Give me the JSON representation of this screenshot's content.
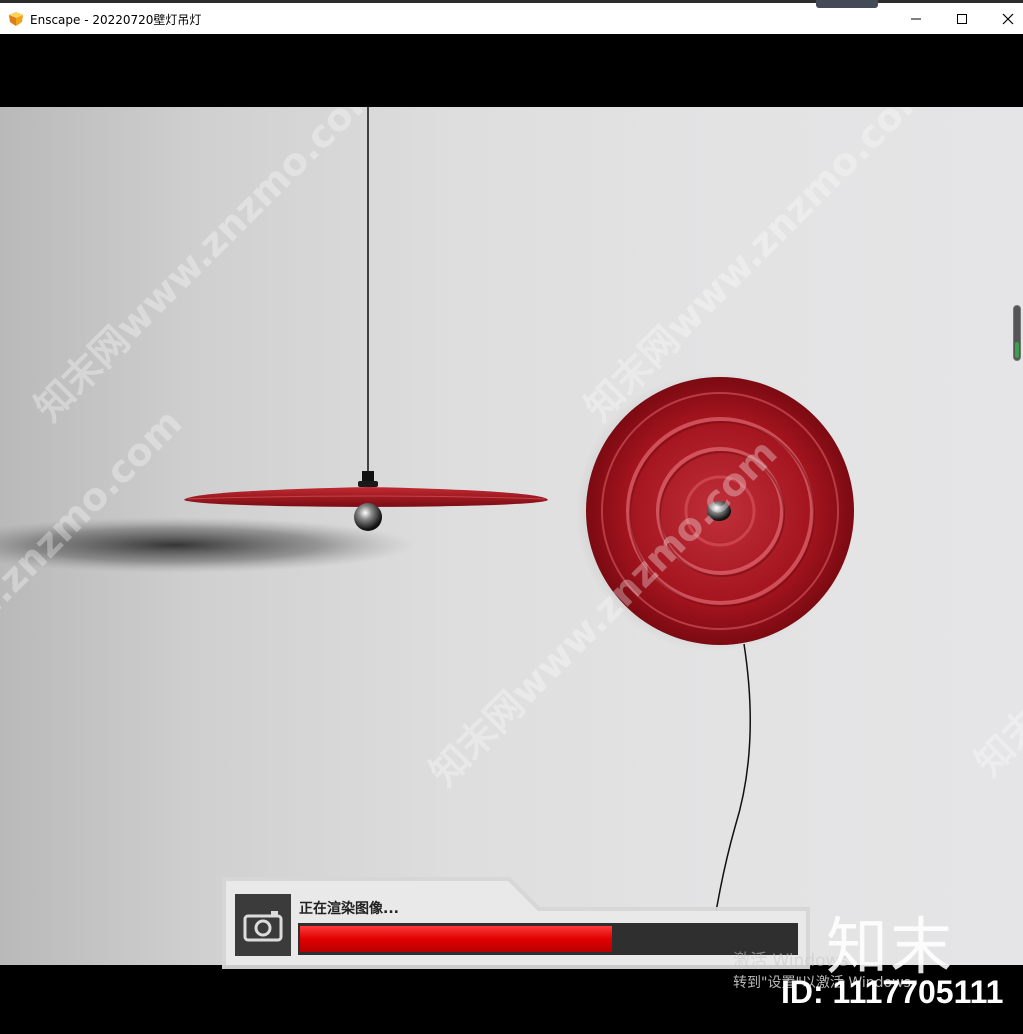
{
  "window": {
    "title": "Enscape - 20220720壁灯吊灯",
    "icon": "enscape-app-icon",
    "controls": [
      "minimize-icon",
      "maximize-icon",
      "close-icon"
    ]
  },
  "render_status": {
    "label": "正在渲染图像...",
    "progress": 0.63,
    "accent_color": "#e00000",
    "icon": "camera-icon"
  },
  "watermarks": {
    "diagonal_text": "知末网www.znzmo.com",
    "windows_activation_title": "激活 Windows",
    "windows_activation_sub": "转到\"设置\"以激活 Windows",
    "brand": "知末",
    "id_label": "ID: 1117705111"
  },
  "scene": {
    "objects": [
      "pendant-lamp",
      "wall-lamp"
    ],
    "lamp_color": "#a3141e",
    "wall_color": "#e2e2e3"
  }
}
